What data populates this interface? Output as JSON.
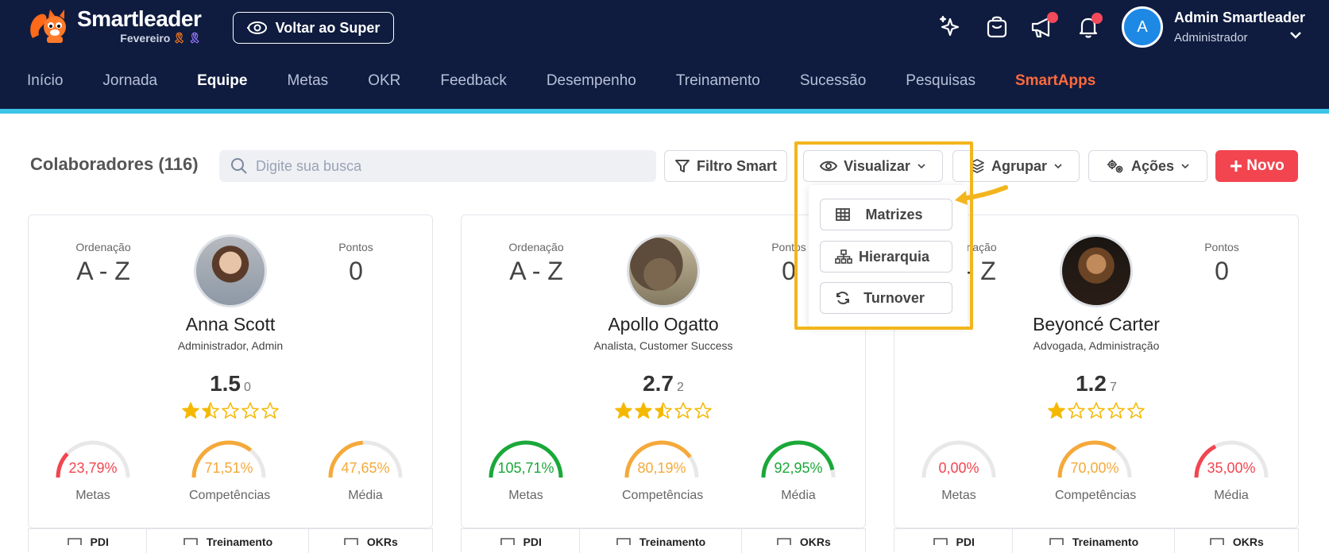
{
  "header": {
    "brand": "Smartleader",
    "month": "Fevereiro",
    "back_label": "Voltar ao Super",
    "user": {
      "initial": "A",
      "name": "Admin Smartleader",
      "role": "Administrador"
    },
    "colors": {
      "bg": "#0f1c3f",
      "stripe": "#3ec4e6",
      "accent": "#ff6a3d",
      "notify": "#f24a5a"
    }
  },
  "nav": [
    "Início",
    "Jornada",
    "Equipe",
    "Metas",
    "OKR",
    "Feedback",
    "Desempenho",
    "Treinamento",
    "Sucessão",
    "Pesquisas",
    "SmartApps"
  ],
  "nav_active": "Equipe",
  "toolbar": {
    "title": "Colaboradores (116)",
    "search_placeholder": "Digite sua busca",
    "filter_label": "Filtro Smart",
    "view_label": "Visualizar",
    "group_label": "Agrupar",
    "actions_label": "Ações",
    "new_label": "Novo"
  },
  "view_menu": {
    "items": [
      {
        "label": "Matrizes",
        "icon": "table-icon"
      },
      {
        "label": "Hierarquia",
        "icon": "hierarchy-icon"
      },
      {
        "label": "Turnover",
        "icon": "refresh-icon"
      }
    ]
  },
  "cards": [
    {
      "order_label": "Ordenação",
      "order_value": "A - Z",
      "points_label": "Pontos",
      "points_value": "0",
      "name": "Anna Scott",
      "role": "Administrador, Admin",
      "score": "1.5",
      "score_count": "0",
      "stars": 1.5,
      "gauges": [
        {
          "value": "23,79%",
          "pct": 23.79,
          "label": "Metas",
          "color": "#f2454f"
        },
        {
          "value": "71,51%",
          "pct": 71.51,
          "label": "Competências",
          "color": "#f5a93a"
        },
        {
          "value": "47,65%",
          "pct": 47.65,
          "label": "Média",
          "color": "#f5a93a"
        }
      ]
    },
    {
      "order_label": "Ordenação",
      "order_value": "A - Z",
      "points_label": "Pontos",
      "points_value": "0",
      "name": "Apollo Ogatto",
      "role": "Analista, Customer Success",
      "score": "2.7",
      "score_count": "2",
      "stars": 2.5,
      "gauges": [
        {
          "value": "105,71%",
          "pct": 100,
          "label": "Metas",
          "color": "#1aa839"
        },
        {
          "value": "80,19%",
          "pct": 80.19,
          "label": "Competências",
          "color": "#f5a93a"
        },
        {
          "value": "92,95%",
          "pct": 92.95,
          "label": "Média",
          "color": "#1aa839"
        }
      ]
    },
    {
      "order_label": "Ordenação",
      "order_value": "A - Z",
      "points_label": "Pontos",
      "points_value": "0",
      "name": "Beyoncé Carter",
      "role": "Advogada, Administração",
      "score": "1.2",
      "score_count": "7",
      "stars": 1,
      "gauges": [
        {
          "value": "0,00%",
          "pct": 0,
          "label": "Metas",
          "color": "#f2454f"
        },
        {
          "value": "70,00%",
          "pct": 70,
          "label": "Competências",
          "color": "#f5a93a"
        },
        {
          "value": "35,00%",
          "pct": 35,
          "label": "Média",
          "color": "#f2454f"
        }
      ]
    }
  ],
  "card_tabs": [
    "PDI",
    "Treinamento",
    "OKRs"
  ]
}
